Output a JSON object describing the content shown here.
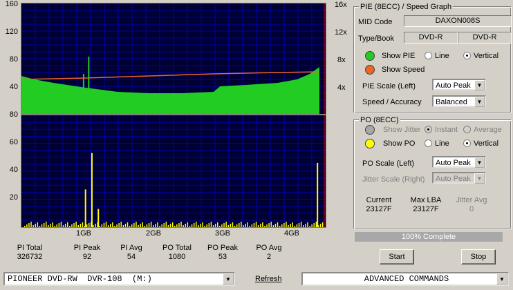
{
  "chart_top": {
    "y_left": [
      "160",
      "120",
      "80",
      "40"
    ],
    "y_right": [
      "16x",
      "12x",
      "8x",
      "4x"
    ]
  },
  "chart_bottom": {
    "y_left": [
      "80",
      "60",
      "40",
      "20"
    ],
    "x_ticks": [
      "1GB",
      "2GB",
      "3GB",
      "4GB"
    ]
  },
  "chart_data": [
    {
      "type": "area",
      "title": "",
      "x_unit": "GB",
      "xlim": [
        0,
        4.7
      ],
      "ylim": [
        0,
        160
      ],
      "y2lim": [
        0,
        16
      ],
      "series": [
        {
          "x": [
            0,
            0.2,
            0.5,
            1.0,
            1.5,
            2.0,
            2.5,
            3.0,
            3.1,
            3.5,
            4.0,
            4.3,
            4.5,
            4.65
          ],
          "y": [
            55,
            50,
            45,
            38,
            32,
            30,
            30,
            32,
            40,
            42,
            45,
            50,
            58,
            68
          ]
        },
        {
          "x": [
            0,
            0.5,
            1.0,
            2.0,
            3.0,
            4.0,
            4.65
          ],
          "y": [
            5.0,
            5.1,
            5.2,
            5.5,
            5.8,
            6.0,
            6.1
          ]
        }
      ],
      "spikes": [
        {
          "x": 1.05,
          "y": 83
        },
        {
          "x": 0.97,
          "y": 58
        }
      ]
    },
    {
      "type": "bar",
      "title": "",
      "x_unit": "GB",
      "xlim": [
        0,
        4.7
      ],
      "ylim": [
        0,
        80
      ],
      "series": [
        {
          "x": [
            1.0,
            1.1,
            1.2,
            4.62
          ],
          "y": [
            27,
            53,
            13,
            46
          ]
        }
      ]
    }
  ],
  "pie_group": {
    "title": "PIE (8ECC) / Speed Graph",
    "mid_label": "MID Code",
    "mid_value": "DAXON008S",
    "type_label": "Type/Book",
    "type_value": "DVD-R",
    "book_value": "DVD-R",
    "show_pie": "Show PIE",
    "show_speed": "Show Speed",
    "line": "Line",
    "vertical": "Vertical",
    "scale_label": "PIE Scale (Left)",
    "scale_value": "Auto Peak",
    "accuracy_label": "Speed / Accuracy",
    "accuracy_value": "Balanced",
    "pie_color": "#22cc22",
    "speed_color": "#ee6622"
  },
  "po_group": {
    "title": "PO (8ECC)",
    "show_jitter": "Show Jitter",
    "instant": "Instant",
    "average": "Average",
    "show_po": "Show PO",
    "line": "Line",
    "vertical": "Vertical",
    "scale_label": "PO Scale (Left)",
    "scale_value": "Auto Peak",
    "jitter_label": "Jitter Scale (Right)",
    "jitter_value": "Auto Peak",
    "current_label": "Current",
    "current_value": "23127F",
    "maxlba_label": "Max LBA",
    "maxlba_value": "23127F",
    "jitteravg_label": "Jitter Avg",
    "jitteravg_value": "0",
    "po_color": "#ffff00"
  },
  "progress": "100% Complete",
  "buttons": {
    "start": "Start",
    "stop": "Stop",
    "refresh": "Refresh"
  },
  "stats": [
    {
      "label": "PI Total",
      "value": "326732"
    },
    {
      "label": "PI Peak",
      "value": "92"
    },
    {
      "label": "PI Avg",
      "value": "54"
    },
    {
      "label": "PO Total",
      "value": "1080"
    },
    {
      "label": "PO Peak",
      "value": "53"
    },
    {
      "label": "PO Avg",
      "value": "2"
    }
  ],
  "drive": "PIONEER DVD-RW  DVR-108  (M:)",
  "commands": "ADVANCED COMMANDS"
}
